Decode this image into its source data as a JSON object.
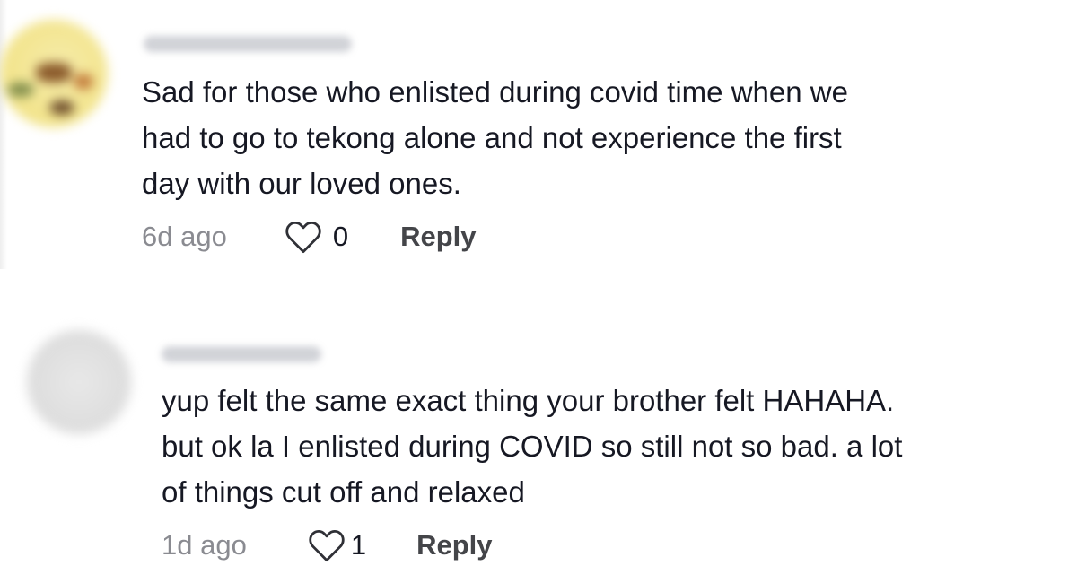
{
  "comments": [
    {
      "text": "Sad for those who enlisted during covid time when we\nhad to go to tekong alone and not experience the first\nday with our loved ones.",
      "time": "6d ago",
      "likes": "0",
      "reply_label": "Reply"
    },
    {
      "text": "yup felt the same exact thing your brother felt HAHAHA.\nbut ok la I enlisted during COVID so still not so bad. a lot\nof things cut off and relaxed",
      "time": "1d ago",
      "likes": "1",
      "reply_label": "Reply"
    }
  ],
  "icons": {
    "like": "heart-outline-icon"
  },
  "colors": {
    "text": "#161823",
    "muted": "#8a8b91",
    "reply": "#444549"
  }
}
